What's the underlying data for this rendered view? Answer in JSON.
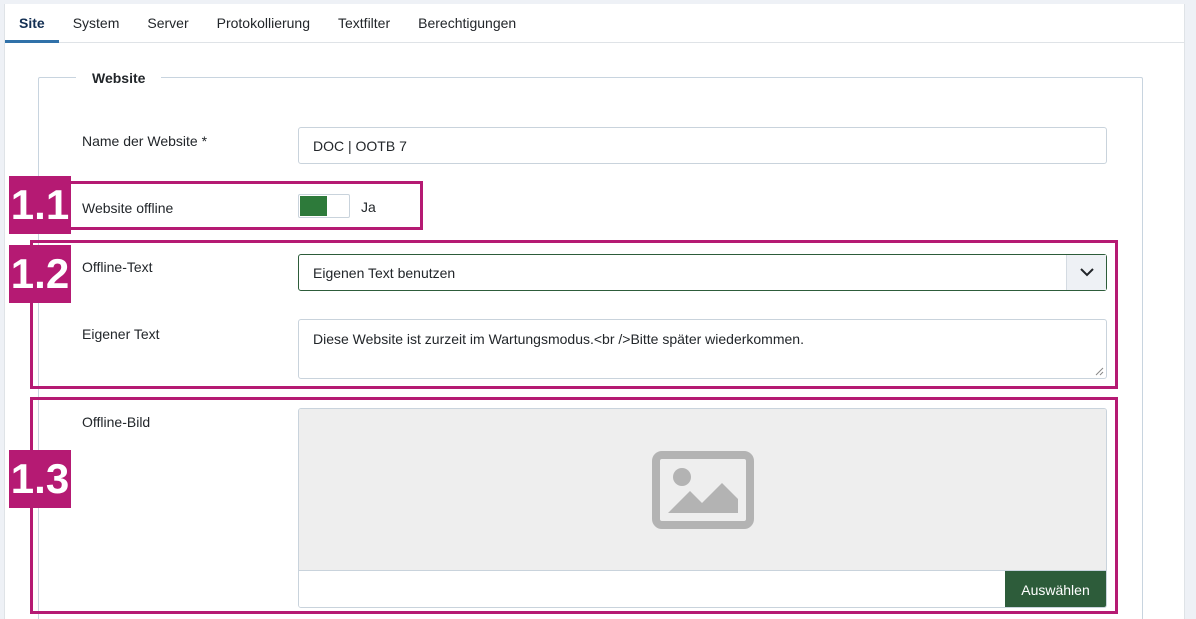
{
  "tabs": [
    {
      "label": "Site",
      "active": true
    },
    {
      "label": "System",
      "active": false
    },
    {
      "label": "Server",
      "active": false
    },
    {
      "label": "Protokollierung",
      "active": false
    },
    {
      "label": "Textfilter",
      "active": false
    },
    {
      "label": "Berechtigungen",
      "active": false
    }
  ],
  "section": {
    "legend": "Website"
  },
  "fields": {
    "site_name": {
      "label": "Name der Website *",
      "value": "DOC | OOTB 7"
    },
    "offline": {
      "label": "Website offline",
      "value_label": "Ja",
      "enabled": true
    },
    "offline_text": {
      "label": "Offline-Text",
      "value": "Eigenen Text benutzen"
    },
    "custom_text": {
      "label": "Eigener Text",
      "value": "Diese Website ist zurzeit im Wartungsmodus.<br />Bitte später wiederkommen."
    },
    "offline_image": {
      "label": "Offline-Bild",
      "button_label": "Auswählen",
      "value": ""
    }
  },
  "annotations": [
    {
      "label": "1.1"
    },
    {
      "label": "1.2"
    },
    {
      "label": "1.3"
    }
  ],
  "colors": {
    "accent": "#b51a73",
    "toggle_on": "#2d7a3a",
    "button": "#2d5c3a",
    "tab_active_underline": "#3071a9"
  },
  "icons": {
    "select_arrow": "chevron-down-icon",
    "image_placeholder": "image-icon"
  }
}
